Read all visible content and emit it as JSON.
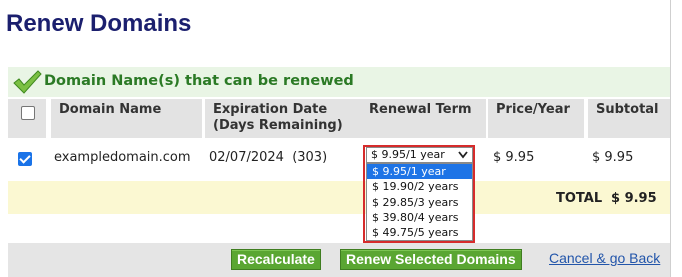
{
  "page": {
    "title": "Renew Domains"
  },
  "section": {
    "title": "Domain Name(s) that can be renewed",
    "icon": "checkmark-icon"
  },
  "table": {
    "headers": {
      "select_all_checked": false,
      "domain_name": "Domain Name",
      "expiration_line1": "Expiration Date",
      "expiration_line2": "(Days Remaining)",
      "renewal_term": "Renewal Term",
      "price_year": "Price/Year",
      "subtotal": "Subtotal"
    },
    "rows": [
      {
        "checked": true,
        "domain": "exampledomain.com",
        "expiration": "02/07/2024  (303)",
        "renewal_term": "$ 9.95/1 year",
        "price": "$ 9.95",
        "subtotal": "$ 9.95"
      }
    ],
    "total_label": "TOTAL",
    "total_value": "$ 9.95"
  },
  "renewal_options": [
    "$ 9.95/1 year",
    "$ 19.90/2 years",
    "$ 29.85/3 years",
    "$ 39.80/4 years",
    "$ 49.75/5 years"
  ],
  "selected_option_index": 0,
  "buttons": {
    "recalculate": "Recalculate",
    "renew_selected": "Renew Selected Domains",
    "cancel": "Cancel & go Back"
  },
  "colors": {
    "title": "#1b1f6e",
    "section_text": "#2b7a25",
    "button": "#5aa632",
    "highlight": "#d62b2b",
    "selected_option": "#1e74e6"
  }
}
